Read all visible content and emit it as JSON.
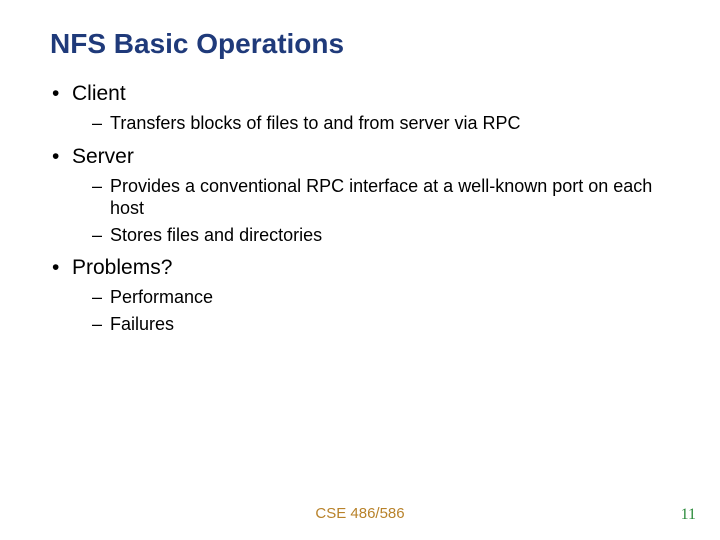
{
  "title": "NFS Basic Operations",
  "bullets": {
    "b1": "Client",
    "b1_1": "Transfers blocks of files to and from server via RPC",
    "b2": "Server",
    "b2_1": "Provides a conventional RPC interface at a well-known port on each host",
    "b2_2": "Stores files and directories",
    "b3": "Problems?",
    "b3_1": "Performance",
    "b3_2": "Failures"
  },
  "footer": "CSE 486/586",
  "page": "11"
}
